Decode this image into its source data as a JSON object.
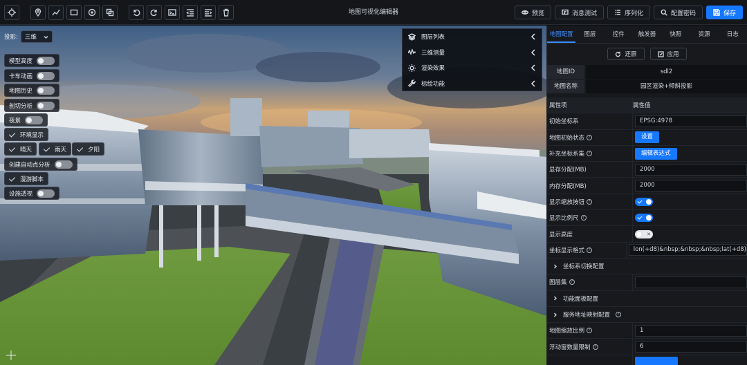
{
  "app": {
    "title": "地图可视化编辑器"
  },
  "toolbar": {
    "icons": [
      "crosshair-icon",
      "location-pin-icon",
      "polyline-icon",
      "rectangle-icon",
      "circle-plus-icon",
      "copy-icon",
      "undo-icon",
      "redo-icon",
      "terminal-icon",
      "indent-left-icon",
      "indent-right-icon",
      "trash-icon"
    ],
    "right_buttons": [
      {
        "id": "preview",
        "label": "预览",
        "icon": "eye-icon"
      },
      {
        "id": "msg-test",
        "label": "消息测试",
        "icon": "message-icon"
      },
      {
        "id": "serialize",
        "label": "序列化",
        "icon": "list-icon"
      },
      {
        "id": "config-search",
        "label": "配置密码",
        "icon": "search-icon"
      },
      {
        "id": "save",
        "label": "保存",
        "icon": "save-icon"
      }
    ]
  },
  "viewport": {
    "projection": {
      "label": "投影:",
      "value": "三维"
    },
    "controls": [
      {
        "label": "模型高度",
        "kind": "toggle",
        "on": false
      },
      {
        "label": "卡车动画",
        "kind": "toggle",
        "on": false
      },
      {
        "label": "地图历史",
        "kind": "toggle",
        "on": false
      },
      {
        "label": "剖切分析",
        "kind": "toggle",
        "on": false
      },
      {
        "label": "夜景",
        "kind": "toggle",
        "on": false
      }
    ],
    "env_display": "环境显示",
    "weather": [
      "晴天",
      "雨天",
      "夕阳"
    ],
    "auto_analysis": {
      "label": "创建自动点分析",
      "on": false
    },
    "roam_script": "漫游脚本",
    "facility_view": {
      "label": "设施透视",
      "on": false
    },
    "layer_panel": [
      {
        "label": "图层列表",
        "icon": "layers-icon"
      },
      {
        "label": "三维测量",
        "icon": "wave-icon"
      },
      {
        "label": "渲染效果",
        "icon": "sun-icon"
      },
      {
        "label": "标绘功能",
        "icon": "wrench-icon"
      }
    ]
  },
  "sidebar": {
    "tabs": [
      "地图配置",
      "图层",
      "控件",
      "触发器",
      "快照",
      "资源",
      "日志"
    ],
    "active_tab": 0,
    "actions": [
      {
        "label": "还原",
        "icon": "refresh-icon"
      },
      {
        "label": "应用",
        "icon": "apply-icon"
      }
    ],
    "map_id": {
      "label": "地图ID",
      "value": "sdl2"
    },
    "map_name": {
      "label": "地图名称",
      "value": "园区渲染+倾斜投影"
    },
    "table_head": {
      "key": "属性项",
      "value": "属性值"
    },
    "rows": [
      {
        "key": "初始坐标系",
        "type": "input",
        "value": "EPSG:4978",
        "help": false
      },
      {
        "key": "地图初始状态",
        "type": "button",
        "value": "设置",
        "help": true
      },
      {
        "key": "补充坐标系集",
        "type": "button",
        "value": "编辑表达式",
        "help": true
      },
      {
        "key": "显存分配(MB)",
        "type": "input",
        "value": "2000",
        "help": false
      },
      {
        "key": "内存分配(MB)",
        "type": "input",
        "value": "2000",
        "help": false
      },
      {
        "key": "显示缩放按钮",
        "type": "switch",
        "on": true,
        "help": true
      },
      {
        "key": "显示比例尺",
        "type": "switch",
        "on": true,
        "help": true
      },
      {
        "key": "显示高度",
        "type": "switch",
        "on": false,
        "help": false
      },
      {
        "key": "坐标显示格式",
        "type": "input",
        "value": "lon(+d8)&nbsp;&nbsp;&nbsp;lat(+d8)",
        "help": true
      },
      {
        "key": "坐标系切换配置",
        "type": "section",
        "help": false
      },
      {
        "key": "图层集",
        "type": "input",
        "value": "",
        "help": true
      },
      {
        "key": "功能面板配置",
        "type": "section",
        "help": false
      },
      {
        "key": "服务地址映射配置",
        "type": "section",
        "help": true
      },
      {
        "key": "地图缩放比例",
        "type": "input",
        "value": "1",
        "help": true
      },
      {
        "key": "浮动窗数量限制",
        "type": "input",
        "value": "6",
        "help": true
      },
      {
        "key": "",
        "type": "button",
        "value": "",
        "help": false
      }
    ]
  },
  "colors": {
    "accent": "#1677ff",
    "panel": "#17191d",
    "topbar": "#141619"
  }
}
